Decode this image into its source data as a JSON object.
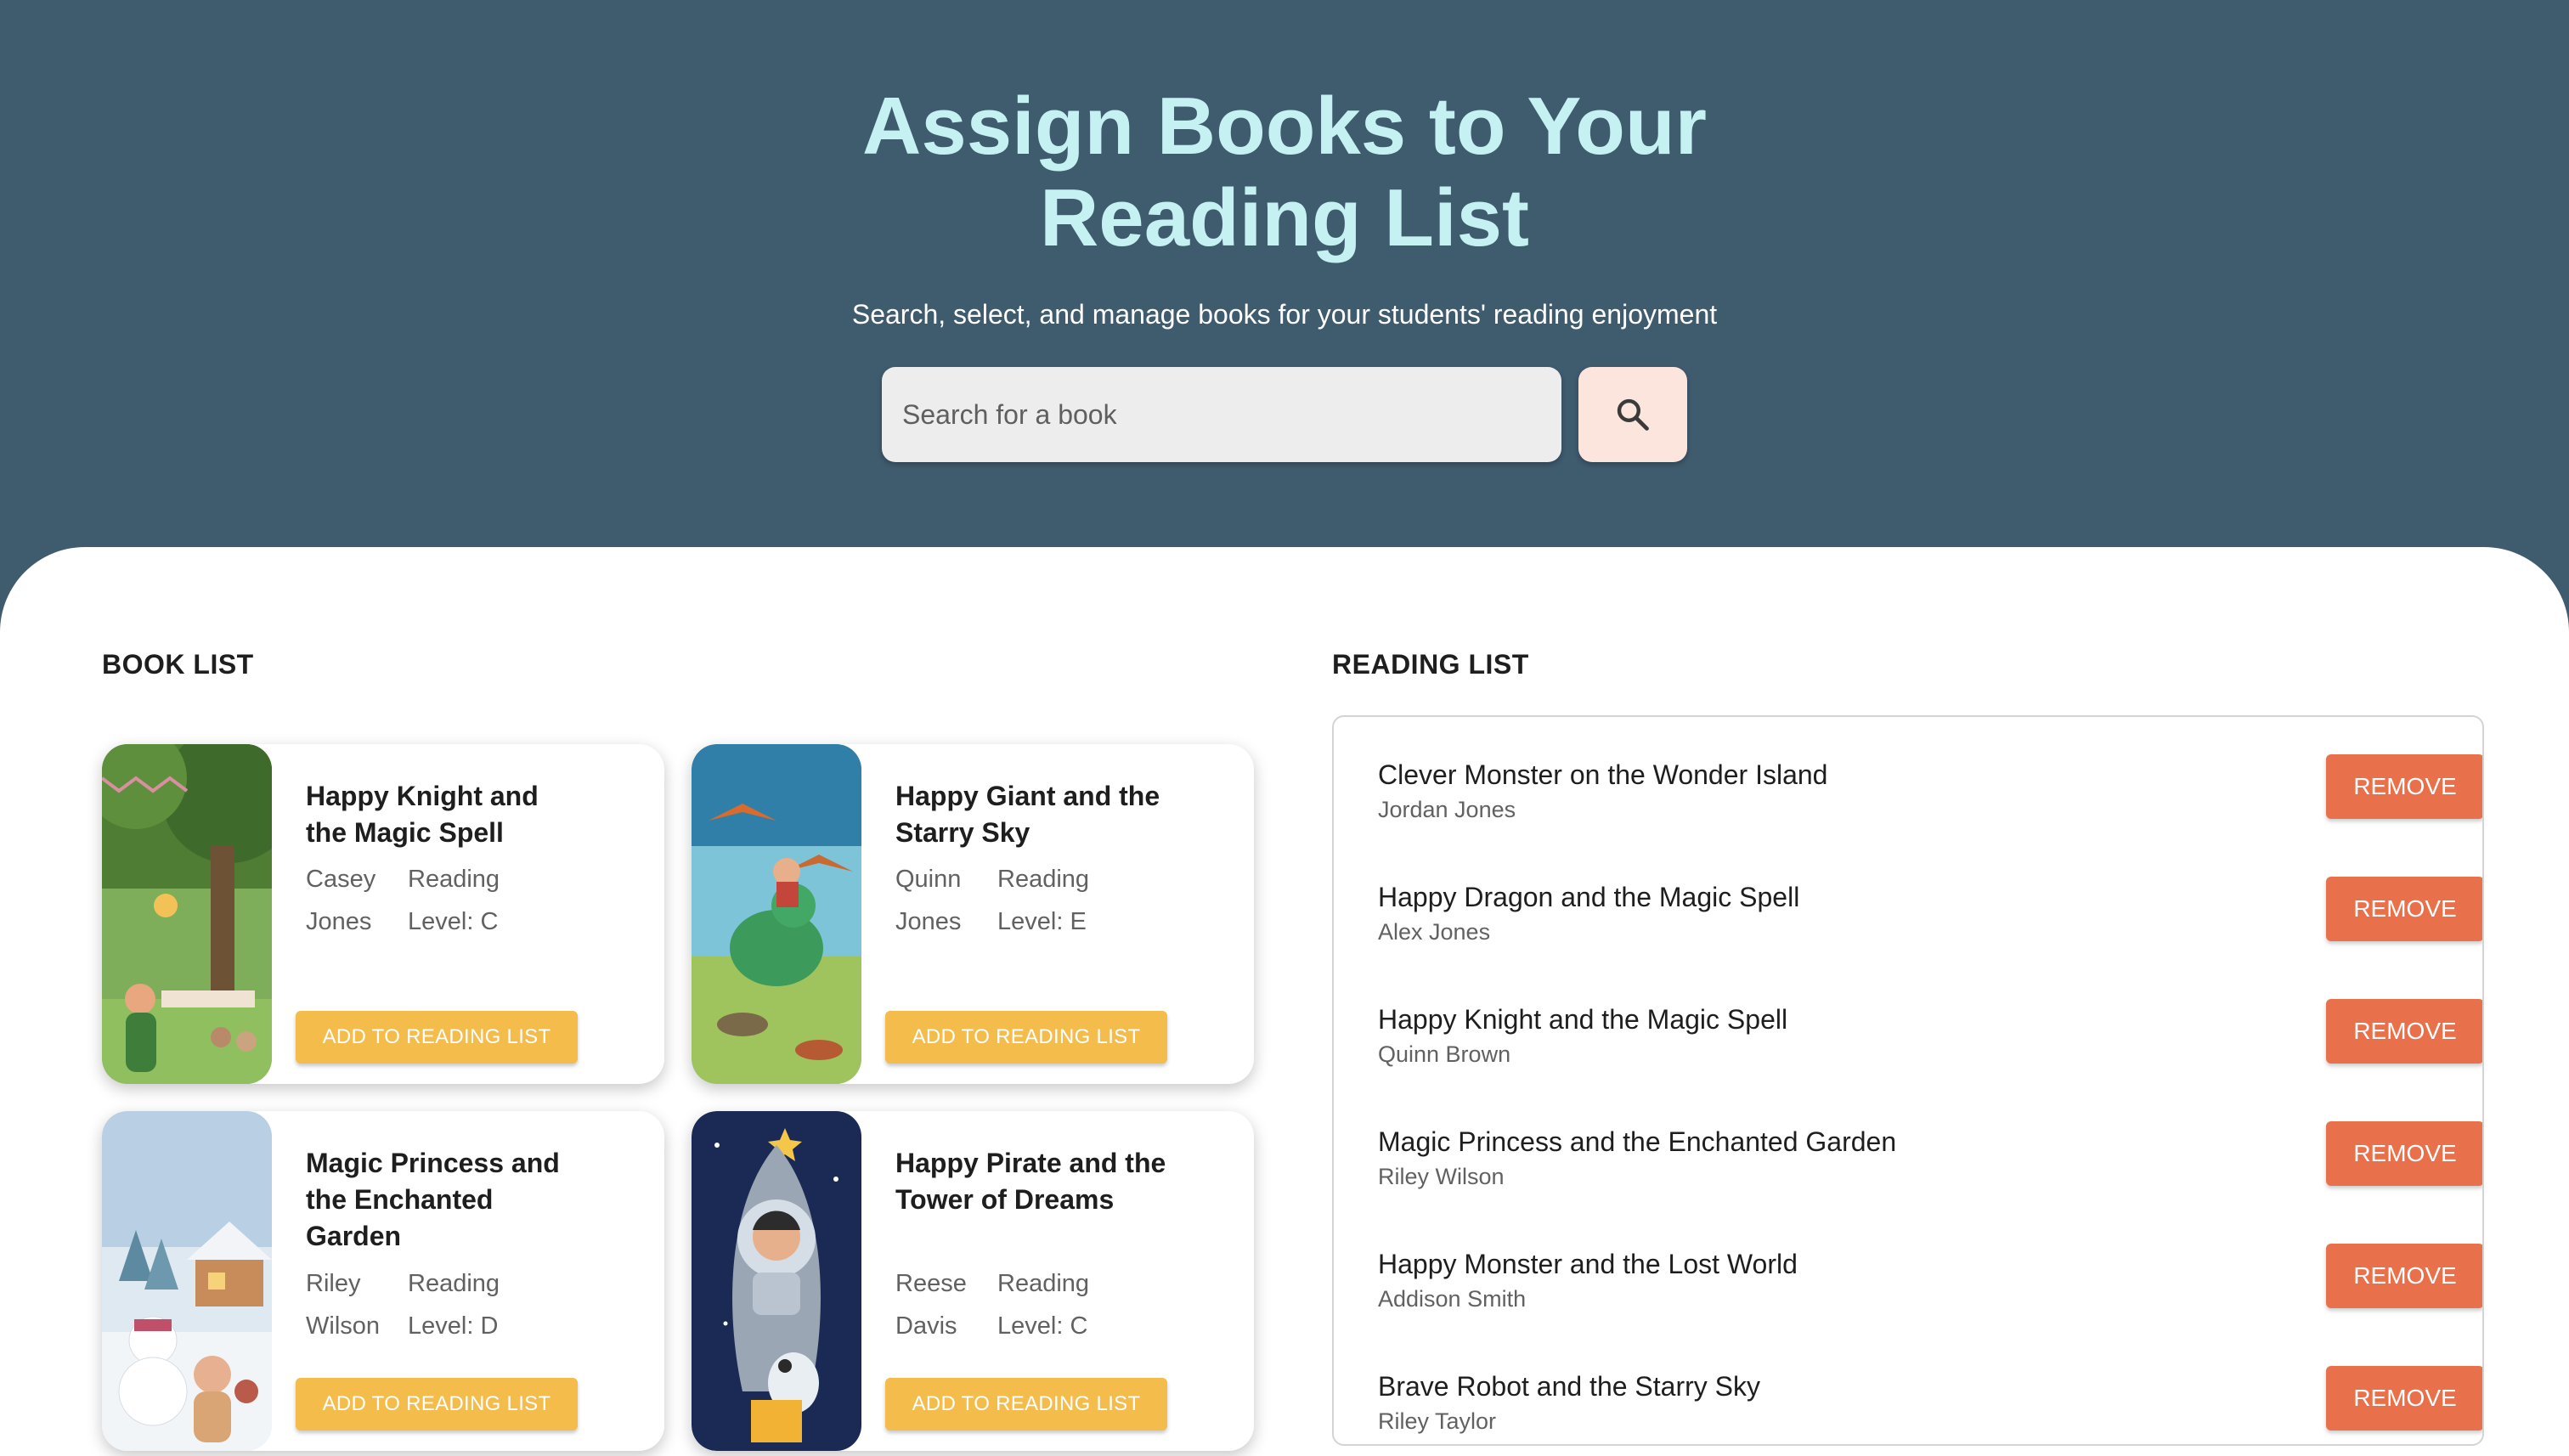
{
  "header": {
    "title_line1": "Assign Books to Your",
    "title_line2": "Reading List",
    "subtitle": "Search, select, and manage books for your students' reading enjoyment"
  },
  "search": {
    "placeholder": "Search for a book",
    "button_icon": "search-icon"
  },
  "book_list": {
    "heading": "BOOK LIST",
    "add_label": "ADD TO READING LIST",
    "books": [
      {
        "title": "Happy Knight and the Magic Spell",
        "author_first": "Casey",
        "author_last": "Jones",
        "level_label": "Reading",
        "level": "Level: C",
        "cover": "fairy-garden-tea-party"
      },
      {
        "title": "Happy Giant and the Starry Sky",
        "author_first": "Quinn",
        "author_last": "Jones",
        "level_label": "Reading",
        "level": "Level: E",
        "cover": "boy-riding-dinosaur"
      },
      {
        "title": "Magic Princess and the Enchanted Garden",
        "author_first": "Riley",
        "author_last": "Wilson",
        "level_label": "Reading",
        "level": "Level: D",
        "cover": "winter-snowman-cottage"
      },
      {
        "title": "Happy Pirate and the Tower of Dreams",
        "author_first": "Reese",
        "author_last": "Davis",
        "level_label": "Reading",
        "level": "Level: C",
        "cover": "astronaut-rocket-dog"
      }
    ]
  },
  "reading_list": {
    "heading": "READING LIST",
    "remove_label": "REMOVE",
    "items": [
      {
        "title": "Clever Monster on the Wonder Island",
        "author": "Jordan Jones"
      },
      {
        "title": "Happy Dragon and the Magic Spell",
        "author": "Alex Jones"
      },
      {
        "title": "Happy Knight and the Magic Spell",
        "author": "Quinn Brown"
      },
      {
        "title": "Magic Princess and the Enchanted Garden",
        "author": "Riley Wilson"
      },
      {
        "title": "Happy Monster and the Lost World",
        "author": "Addison Smith"
      },
      {
        "title": "Brave Robot and the Starry Sky",
        "author": "Riley Taylor"
      }
    ]
  },
  "colors": {
    "header_bg": "#3f5b6e",
    "title": "#c6f1f2",
    "add_button": "#f3bc4b",
    "remove_button": "#e8704a",
    "search_button_bg": "#fbe5dc"
  }
}
